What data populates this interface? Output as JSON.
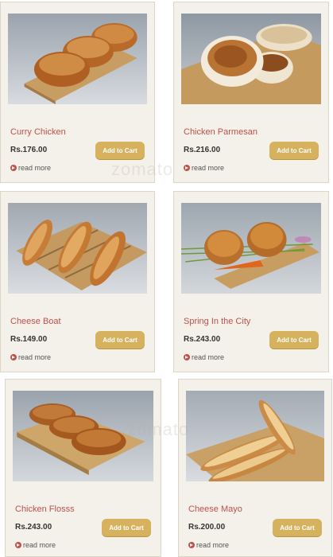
{
  "cta_label": "Add to Cart",
  "more_label": "read more",
  "watermark": "zomato",
  "products": [
    {
      "name": "Curry Chicken",
      "price": "Rs.176.00"
    },
    {
      "name": "Chicken Parmesan",
      "price": "Rs.216.00"
    },
    {
      "name": "Cheese Boat",
      "price": "Rs.149.00"
    },
    {
      "name": "Spring In the City",
      "price": "Rs.243.00"
    },
    {
      "name": "Chicken Flosss",
      "price": "Rs.243.00"
    },
    {
      "name": "Cheese Mayo",
      "price": "Rs.200.00"
    }
  ],
  "colors": {
    "card_bg": "#f4f1ea",
    "name": "#c0504a",
    "button": "#d6b25e"
  }
}
